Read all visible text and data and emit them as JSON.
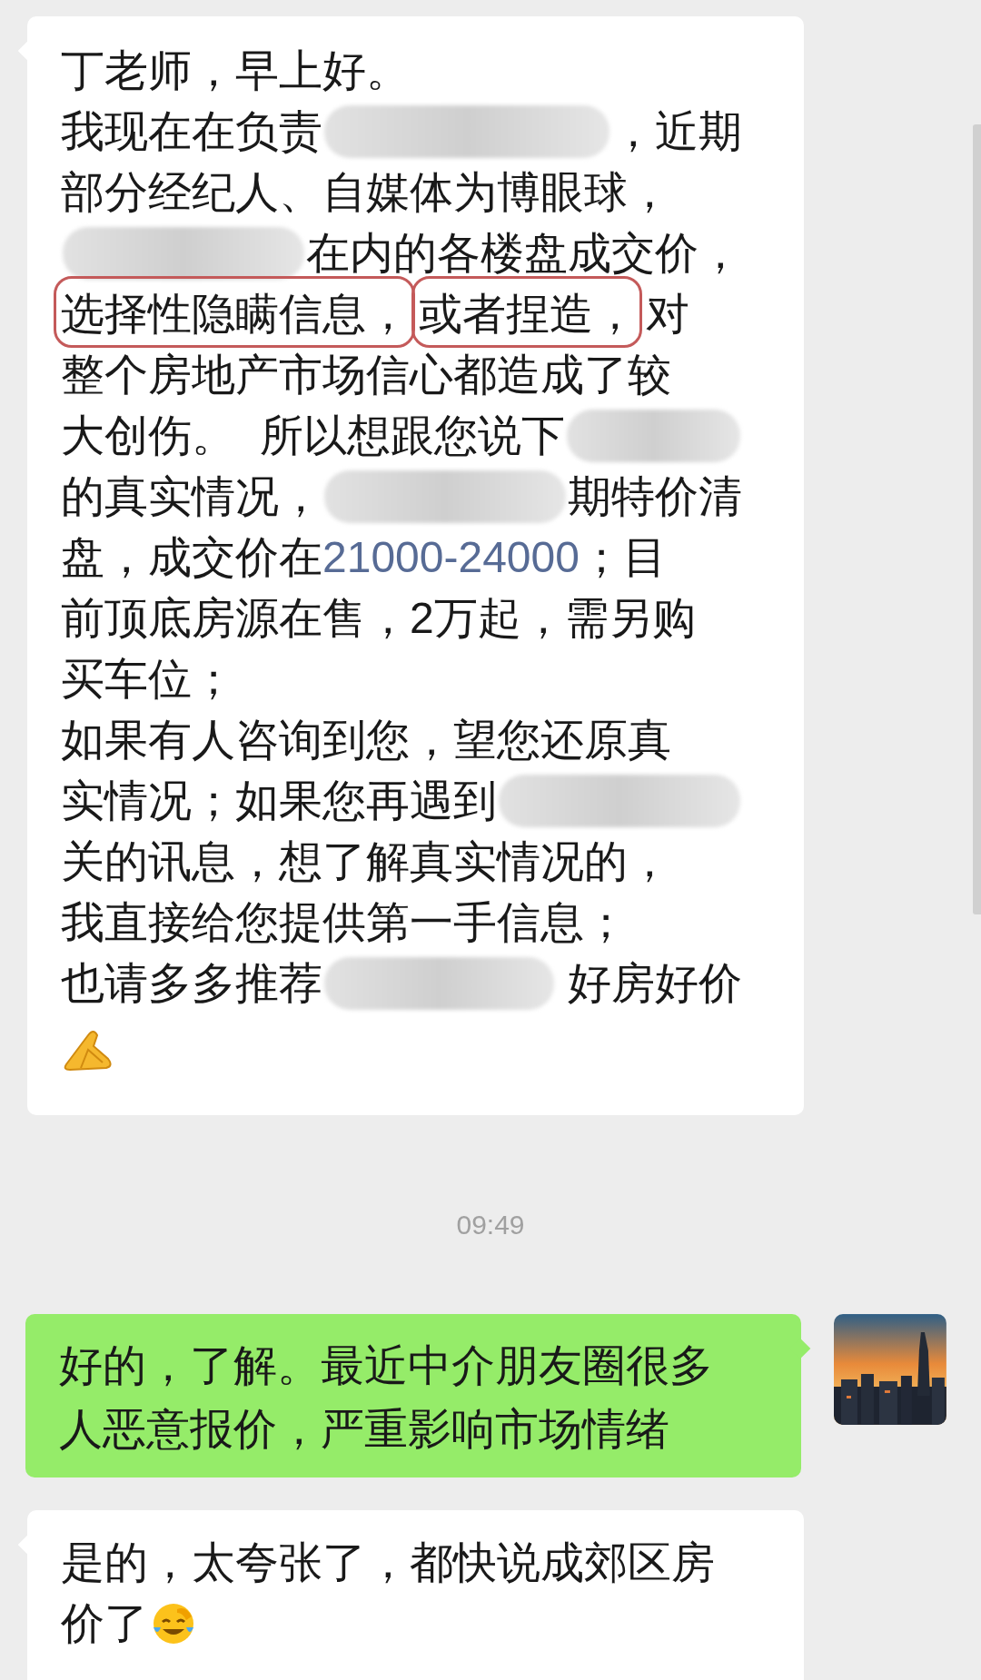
{
  "messages": [
    {
      "kind": "lines",
      "outgoing": false,
      "lines": [
        [
          {
            "kind": "text",
            "text": "丁老师，早上好。"
          }
        ],
        [
          {
            "kind": "text",
            "text": "我现在在负责"
          },
          {
            "kind": "blur"
          },
          {
            "kind": "text",
            "text": "，近期"
          }
        ],
        [
          {
            "kind": "text",
            "text": "部分经纪人、自媒体为博眼球，"
          }
        ],
        [
          {
            "kind": "blur"
          },
          {
            "kind": "text",
            "text": "在内的各楼盘成交价，"
          }
        ],
        [
          {
            "kind": "text",
            "text": "选择性隐瞒信息，",
            "circled": true
          },
          {
            "kind": "text",
            "text": "或者捏造，",
            "circled": true
          },
          {
            "kind": "text",
            "text": "对"
          }
        ],
        [
          {
            "kind": "text",
            "text": "整个房地产市场信心都造成了较"
          }
        ],
        [
          {
            "kind": "text",
            "text": "大创伤。  所以想跟您说下"
          },
          {
            "kind": "blur"
          }
        ],
        [
          {
            "kind": "text",
            "text": "的真实情况，"
          },
          {
            "kind": "blur"
          },
          {
            "kind": "text",
            "text": "期特价清"
          }
        ],
        [
          {
            "kind": "text",
            "text": "盘，成交价在"
          },
          {
            "kind": "link",
            "text": "21000-24000"
          },
          {
            "kind": "text",
            "text": "；目"
          }
        ],
        [
          {
            "kind": "text",
            "text": "前顶底房源在售，2万起，需另购"
          }
        ],
        [
          {
            "kind": "text",
            "text": "买车位；"
          }
        ],
        [
          {
            "kind": "text",
            "text": "如果有人咨询到您，望您还原真"
          }
        ],
        [
          {
            "kind": "text",
            "text": "实情况；如果您再遇到"
          },
          {
            "kind": "blur"
          }
        ],
        [
          {
            "kind": "text",
            "text": "关的讯息，想了解真实情况的，"
          }
        ],
        [
          {
            "kind": "text",
            "text": "我直接给您提供第一手信息；"
          }
        ],
        [
          {
            "kind": "text",
            "text": "也请多多推荐"
          },
          {
            "kind": "blur"
          },
          {
            "kind": "text",
            "text": " 好房好价"
          }
        ],
        [
          {
            "kind": "hands"
          }
        ]
      ]
    },
    {
      "kind": "time",
      "text": "09:49"
    },
    {
      "kind": "text",
      "outgoing": true,
      "text": "好的，了解。最近中介朋友圈很多人恶意报价，严重影响市场情绪"
    },
    {
      "kind": "lines",
      "outgoing": false,
      "lines": [
        [
          {
            "kind": "text",
            "text": "是的，太夸张了，都快说成郊区房"
          }
        ],
        [
          {
            "kind": "text",
            "text": "价了"
          },
          {
            "kind": "tears"
          }
        ]
      ]
    }
  ]
}
